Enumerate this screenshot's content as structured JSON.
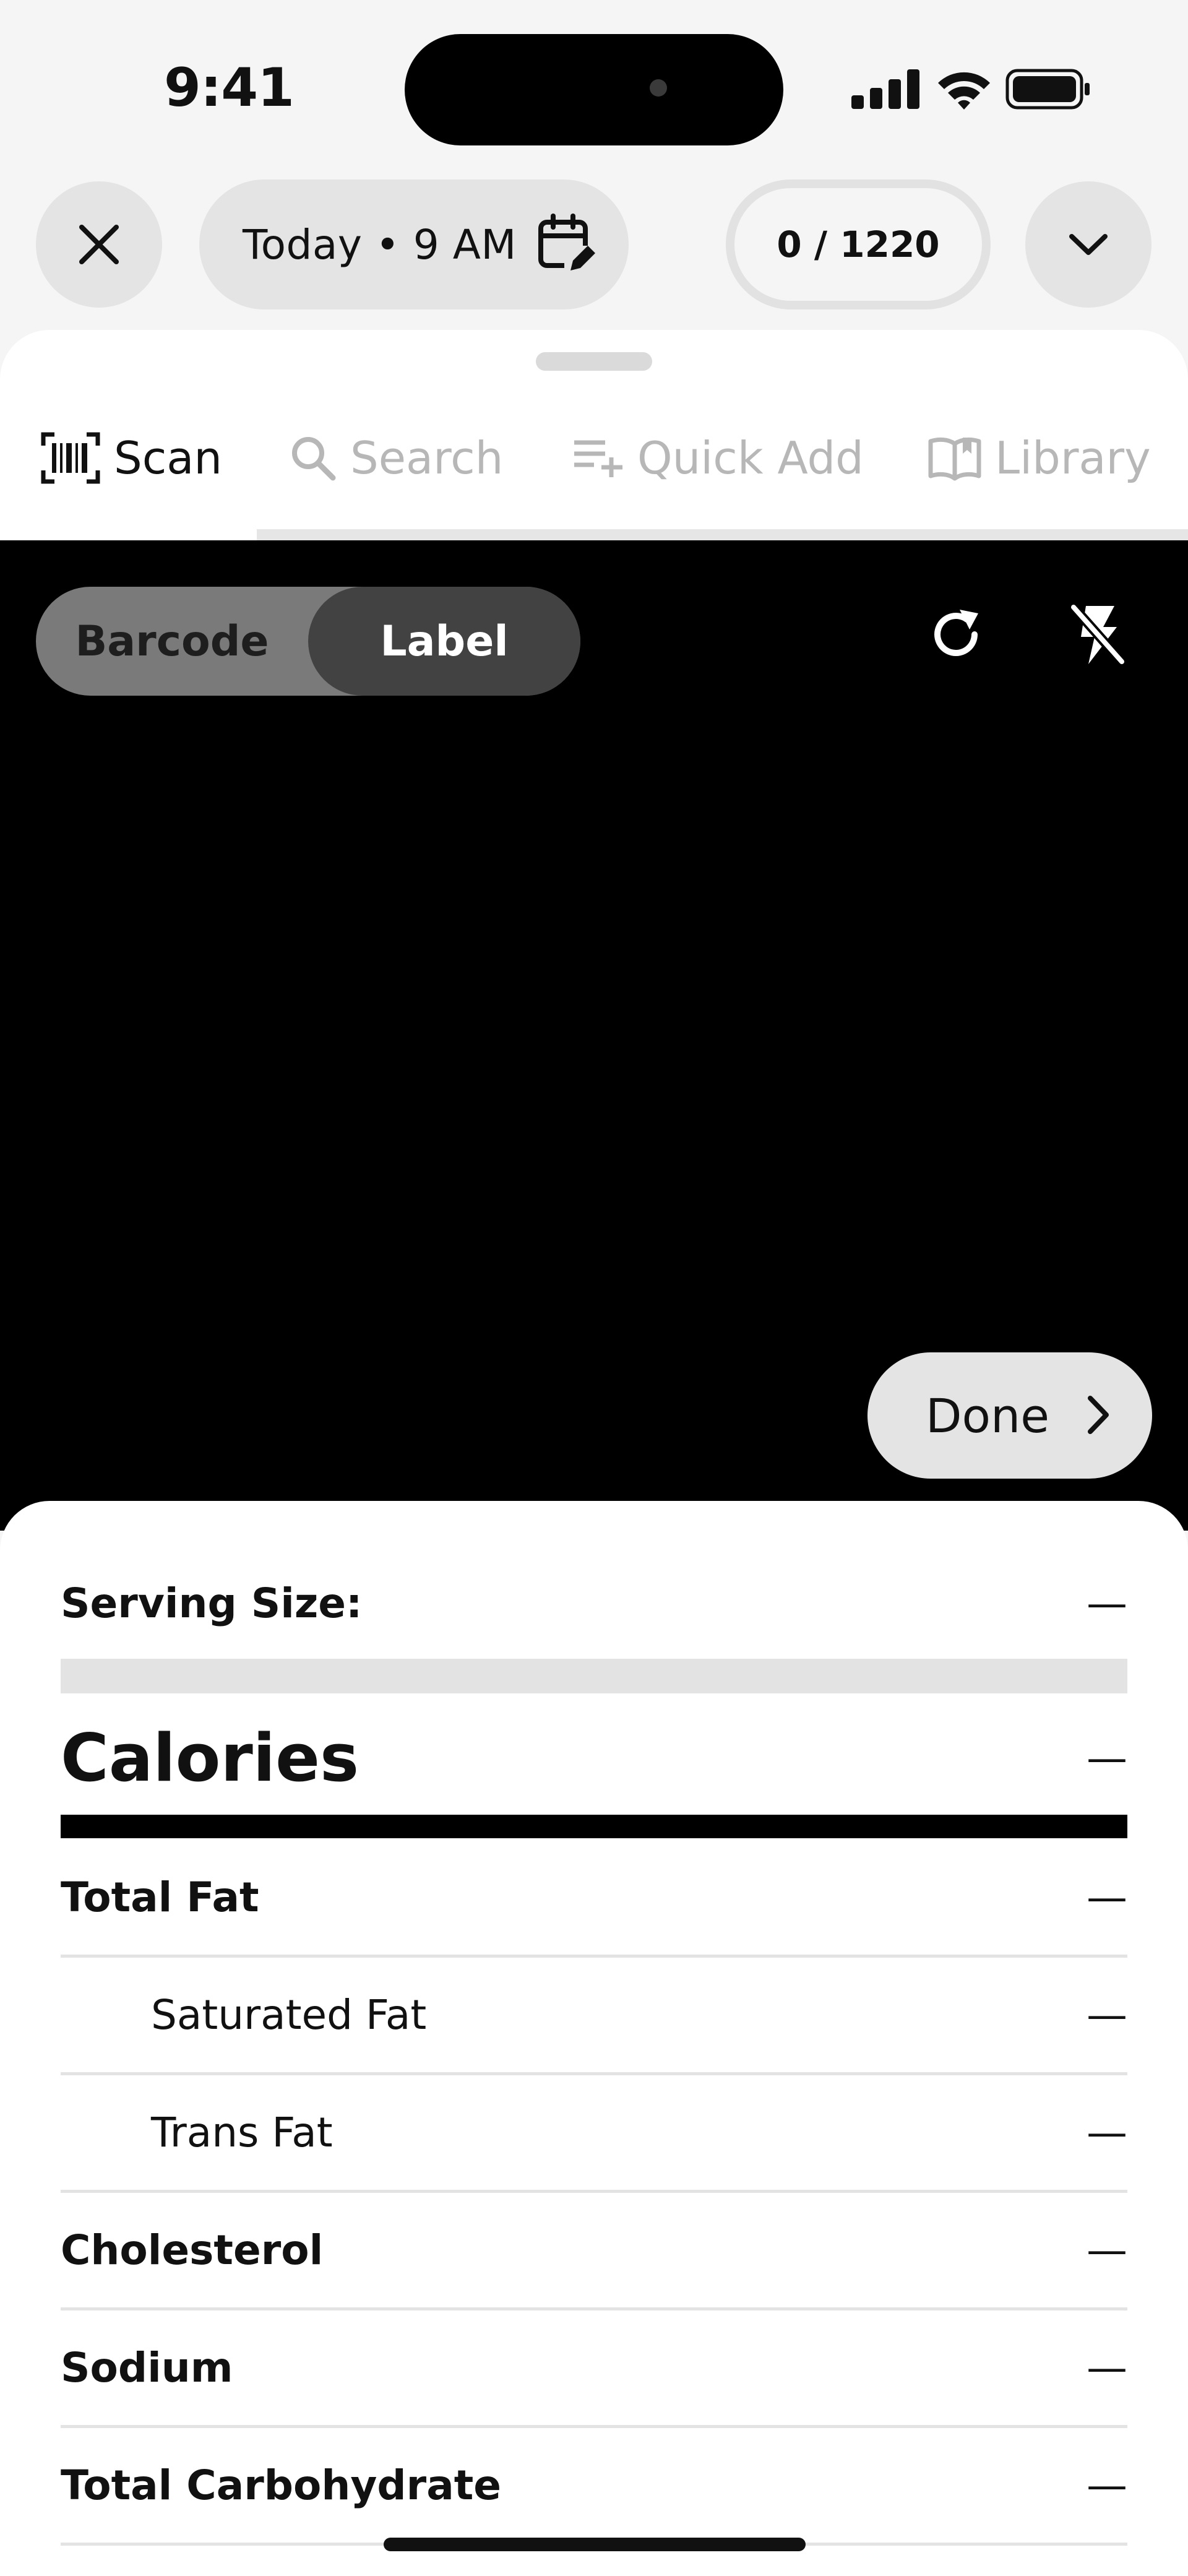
{
  "status": {
    "time": "9:41",
    "icons": [
      "cellular-signal-icon",
      "wifi-icon",
      "battery-icon"
    ]
  },
  "header": {
    "date_label": "Today • 9 AM",
    "calorie_counter": "0 / 1220"
  },
  "tabs": [
    {
      "label": "Scan",
      "icon": "barcode-scan-icon",
      "selected": true
    },
    {
      "label": "Search",
      "icon": "search-icon",
      "selected": false
    },
    {
      "label": "Quick Add",
      "icon": "quick-add-icon",
      "selected": false
    },
    {
      "label": "Library",
      "icon": "library-book-icon",
      "selected": false
    }
  ],
  "scanner": {
    "modes": [
      {
        "label": "Barcode",
        "selected": false
      },
      {
        "label": "Label",
        "selected": true
      }
    ],
    "done_label": "Done"
  },
  "nutrition": {
    "serving_size": {
      "label": "Serving Size:",
      "value": "—"
    },
    "calories": {
      "label": "Calories",
      "value": "—"
    },
    "rows": [
      {
        "label": "Total Fat",
        "value": "—"
      },
      {
        "label": "Saturated Fat",
        "value": "—"
      },
      {
        "label": "Trans Fat",
        "value": "—"
      },
      {
        "label": "Cholesterol",
        "value": "—"
      },
      {
        "label": "Sodium",
        "value": "—"
      },
      {
        "label": "Total Carbohydrate",
        "value": "—"
      }
    ]
  },
  "colors": {
    "background": "#f5f5f5",
    "pill": "#e4e4e4",
    "camera": "#000000",
    "inactive_tab": "#b7b7b7",
    "segment_selected": "#424242",
    "segment_track": "#7a7a7a"
  }
}
